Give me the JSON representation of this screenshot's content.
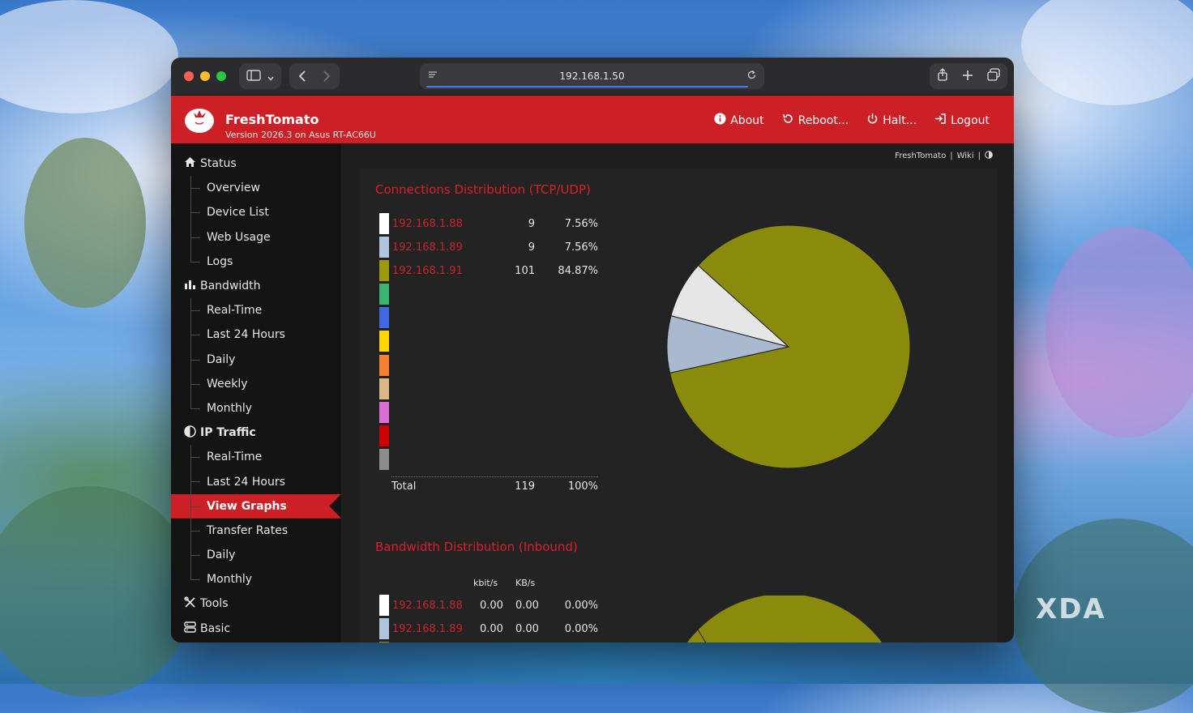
{
  "browser": {
    "url": "192.168.1.50"
  },
  "app": {
    "brand": "FreshTomato",
    "version": "Version 2026.3 on Asus RT-AC66U",
    "nav": {
      "about": "About",
      "reboot": "Reboot...",
      "halt": "Halt...",
      "logout": "Logout"
    },
    "breadcrumb": {
      "home": "FreshTomato",
      "wiki": "Wiki",
      "sep": "|"
    }
  },
  "sidebar": {
    "status": "Status",
    "status_items": [
      "Overview",
      "Device List",
      "Web Usage",
      "Logs"
    ],
    "bandwidth": "Bandwidth",
    "bandwidth_items": [
      "Real-Time",
      "Last 24 Hours",
      "Daily",
      "Weekly",
      "Monthly"
    ],
    "ip_traffic": "IP Traffic",
    "ip_traffic_items": [
      "Real-Time",
      "Last 24 Hours",
      "View Graphs",
      "Transfer Rates",
      "Daily",
      "Monthly"
    ],
    "tools": "Tools",
    "basic": "Basic"
  },
  "connections": {
    "title": "Connections Distribution (TCP/UDP)",
    "rows": [
      {
        "ip": "192.168.1.88",
        "count": "9",
        "pct": "7.56%"
      },
      {
        "ip": "192.168.1.89",
        "count": "9",
        "pct": "7.56%"
      },
      {
        "ip": "192.168.1.91",
        "count": "101",
        "pct": "84.87%"
      }
    ],
    "total_label": "Total",
    "total_count": "119",
    "total_pct": "100%",
    "swatch_colors": [
      "#ffffff",
      "#b0c4de",
      "#9a9a0a",
      "#3cb371",
      "#4169e1",
      "#ffd700",
      "#f58232",
      "#deb887",
      "#da70d6",
      "#cc0000",
      "#8c8c8c"
    ]
  },
  "bandwidth_inbound": {
    "title": "Bandwidth Distribution (Inbound)",
    "col_kbit": "kbit/s",
    "col_kbs": "KB/s",
    "rows": [
      {
        "ip": "192.168.1.88",
        "kbit": "0.00",
        "kbs": "0.00",
        "pct": "0.00%"
      },
      {
        "ip": "192.168.1.89",
        "kbit": "0.00",
        "kbs": "0.00",
        "pct": "0.00%"
      }
    ]
  },
  "chart_data": {
    "type": "pie",
    "title": "Connections Distribution (TCP/UDP)",
    "categories": [
      "192.168.1.88",
      "192.168.1.89",
      "192.168.1.91"
    ],
    "values": [
      9,
      9,
      101
    ],
    "colors": [
      "#e6e6e6",
      "#a9b9cf",
      "#8a8a0c"
    ]
  },
  "watermark": "XDA"
}
